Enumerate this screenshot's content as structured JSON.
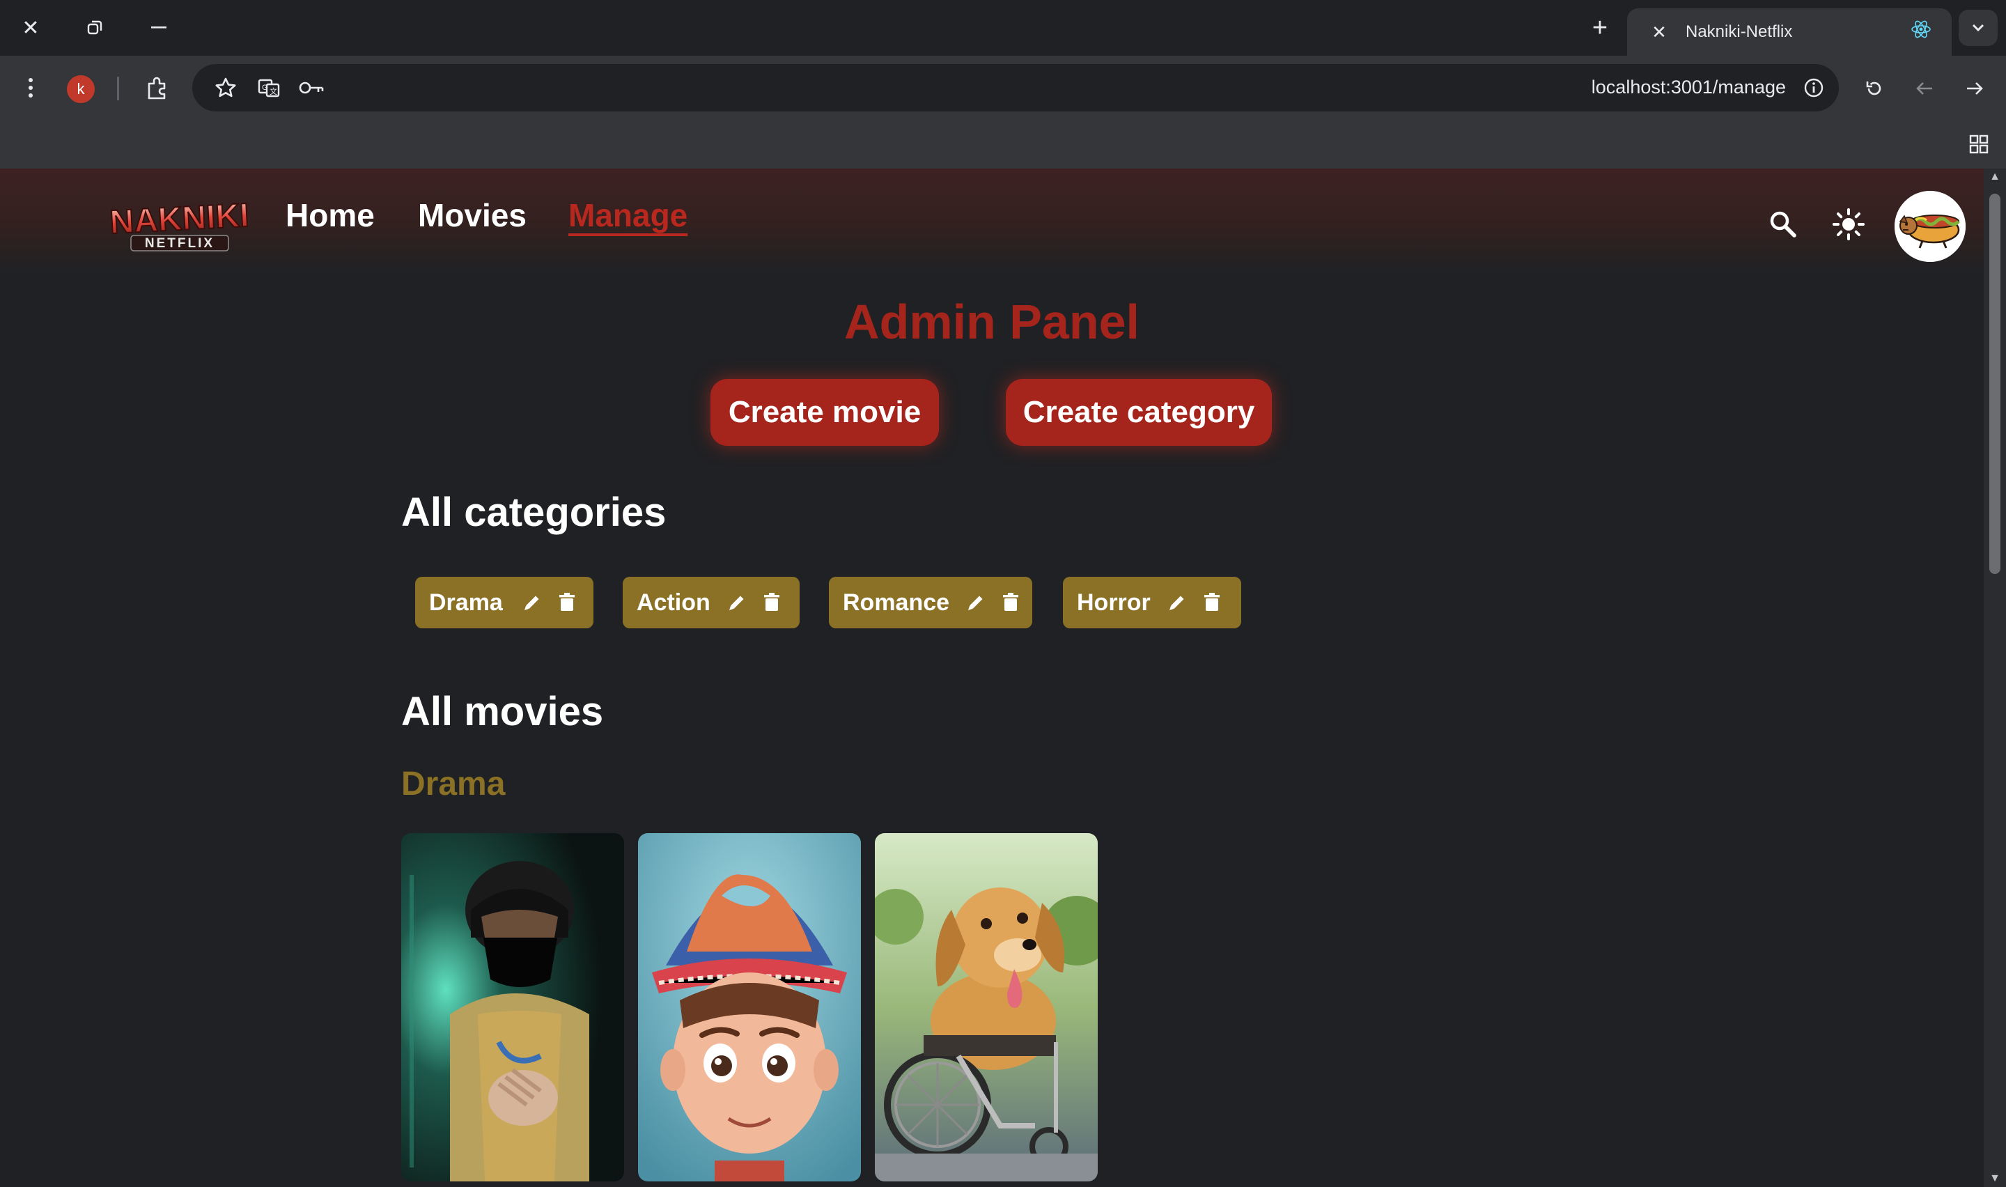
{
  "browser": {
    "tab_title": "Nakniki-Netflix",
    "url": "localhost:3001/manage",
    "profile_initial": "k"
  },
  "nav": {
    "logo_text": "NAKNIKI",
    "logo_subtext": "NETFLIX",
    "links": [
      {
        "label": "Home",
        "active": false
      },
      {
        "label": "Movies",
        "active": false
      },
      {
        "label": "Manage",
        "active": true
      }
    ]
  },
  "admin": {
    "title": "Admin Panel",
    "create_movie_label": "Create movie",
    "create_category_label": "Create category"
  },
  "categories": {
    "title": "All categories",
    "items": [
      {
        "label": "Drama"
      },
      {
        "label": "Action"
      },
      {
        "label": "Romance"
      },
      {
        "label": "Horror"
      }
    ]
  },
  "movies": {
    "title": "All movies",
    "groups": [
      {
        "category": "Drama",
        "posters": [
          "masked-ninja-poster",
          "cartoon-boy-poster",
          "dog-wheelchair-poster"
        ]
      }
    ]
  },
  "colors": {
    "accent_red": "#a5251c",
    "category_gold": "#8a7125",
    "background": "#202124"
  }
}
